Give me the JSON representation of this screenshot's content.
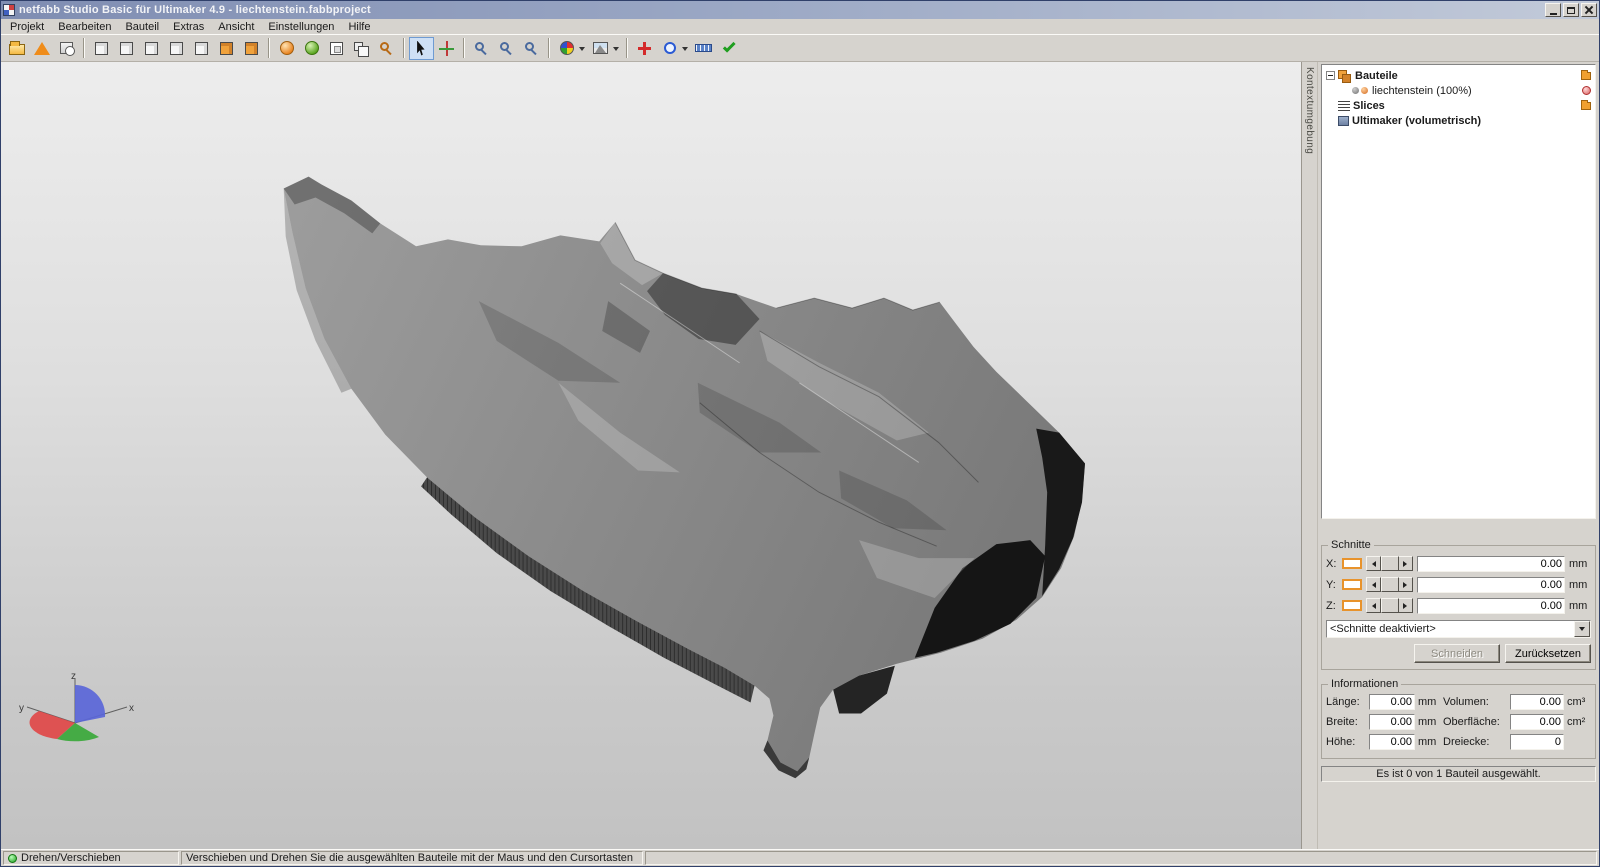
{
  "window": {
    "title": "netfabb Studio Basic für Ultimaker 4.9 - liechtenstein.fabbproject"
  },
  "menu": {
    "items": [
      "Projekt",
      "Bearbeiten",
      "Bauteil",
      "Extras",
      "Ansicht",
      "Einstellungen",
      "Hilfe"
    ]
  },
  "toolbar": {
    "groups": [
      {
        "icons": [
          {
            "name": "open-project"
          },
          {
            "name": "part-pyramid"
          },
          {
            "name": "project-clock"
          }
        ]
      },
      {
        "icons": [
          {
            "name": "view-isometric",
            "type": "cube"
          },
          {
            "name": "view-front",
            "type": "cube"
          },
          {
            "name": "view-back",
            "type": "cube"
          },
          {
            "name": "view-left",
            "type": "cube"
          },
          {
            "name": "view-right",
            "type": "cube"
          },
          {
            "name": "view-top",
            "type": "cube",
            "filled": true
          },
          {
            "name": "view-bottom",
            "type": "cube",
            "filled": true
          }
        ]
      },
      {
        "icons": [
          {
            "name": "shading-sphere",
            "type": "sphere-o"
          },
          {
            "name": "shading-sphere-green",
            "type": "sphere-g"
          },
          {
            "name": "single-platform",
            "type": "plat1"
          },
          {
            "name": "multi-platform",
            "type": "plat2"
          },
          {
            "name": "zoom-to-fit",
            "type": "mag-o"
          }
        ]
      },
      {
        "icons": [
          {
            "name": "select-cursor",
            "active": true
          },
          {
            "name": "rotate-tool"
          }
        ]
      },
      {
        "icons": [
          {
            "name": "zoom-in",
            "type": "mag-b"
          },
          {
            "name": "zoom-window",
            "type": "mag-b"
          },
          {
            "name": "zoom-out",
            "type": "mag-b"
          }
        ]
      },
      {
        "icons": [
          {
            "name": "color-wheel",
            "dropdown": true
          },
          {
            "name": "texture-view",
            "dropdown": true
          }
        ]
      },
      {
        "icons": [
          {
            "name": "repair-add"
          },
          {
            "name": "edit-tool",
            "dropdown": true
          },
          {
            "name": "measure-tool"
          },
          {
            "name": "validate-check"
          }
        ]
      }
    ]
  },
  "viewport": {
    "axes": {
      "x": "x",
      "y": "y",
      "z": "z"
    }
  },
  "sidebar": {
    "tab_label": "Kontextumgebung",
    "tree": {
      "rows": [
        {
          "label": "Bauteile",
          "level": 0,
          "bold": true,
          "icon": "parts",
          "expander": true,
          "right_icon": "folder-orange"
        },
        {
          "label": "liechtenstein (100%)",
          "level": 1,
          "bold": false,
          "icon": "part",
          "expander": false,
          "right_icon": "remove-red"
        },
        {
          "label": "Slices",
          "level": 0,
          "bold": true,
          "icon": "slices",
          "expander": false,
          "right_icon": "folder-orange"
        },
        {
          "label": "Ultimaker (volumetrisch)",
          "level": 0,
          "bold": true,
          "icon": "machine",
          "expander": false,
          "right_icon": ""
        }
      ]
    },
    "schnitte": {
      "title": "Schnitte",
      "axes": [
        {
          "key": "x",
          "label": "X:",
          "value": "0.00",
          "unit": "mm"
        },
        {
          "key": "y",
          "label": "Y:",
          "value": "0.00",
          "unit": "mm"
        },
        {
          "key": "z",
          "label": "Z:",
          "value": "0.00",
          "unit": "mm"
        }
      ],
      "dropdown_value": "<Schnitte deaktiviert>",
      "buttons": [
        {
          "key": "schneiden",
          "label": "Schneiden",
          "enabled": false
        },
        {
          "key": "zuruecksetzen",
          "label": "Zurücksetzen",
          "enabled": true
        }
      ]
    },
    "informationen": {
      "title": "Informationen",
      "fields": [
        {
          "key": "laenge",
          "label": "Länge:",
          "value": "0.00",
          "unit": "mm"
        },
        {
          "key": "volumen",
          "label": "Volumen:",
          "value": "0.00",
          "unit": "cm³"
        },
        {
          "key": "breite",
          "label": "Breite:",
          "value": "0.00",
          "unit": "mm"
        },
        {
          "key": "oberflaeche",
          "label": "Oberfläche:",
          "value": "0.00",
          "unit": "cm²"
        },
        {
          "key": "hoehe",
          "label": "Höhe:",
          "value": "0.00",
          "unit": "mm"
        },
        {
          "key": "dreiecke",
          "label": "Dreiecke:",
          "value": "0",
          "unit": ""
        }
      ]
    },
    "selection_status": "Es ist 0 von 1 Bauteil ausgewählt."
  },
  "statusbar": {
    "mode": "Drehen/Verschieben",
    "hint": "Verschieben und Drehen Sie die ausgewählten Bauteile mit der Maus und den Cursortasten"
  },
  "colors": {
    "accent_orange": "#e8932c",
    "chrome_gray": "#d6d3ce",
    "active_tool_highlight": "#cfe0f5",
    "status_green": "#1f9e1f"
  }
}
